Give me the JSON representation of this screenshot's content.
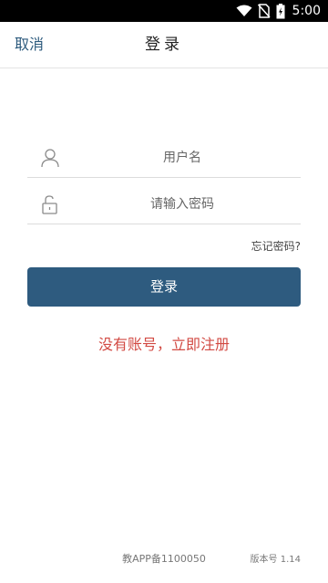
{
  "status_bar": {
    "time": "5:00"
  },
  "header": {
    "cancel": "取消",
    "title": "登录"
  },
  "form": {
    "username_placeholder": "用户名",
    "password_placeholder": "请输入密码",
    "forgot": "忘记密码?",
    "login_label": "登录"
  },
  "register_link": "没有账号，立即注册",
  "footer": {
    "icp": "教APP备1100050",
    "version": "版本号 1.14"
  },
  "colors": {
    "primary": "#2e5b7f",
    "accent_red": "#d24a43",
    "link_blue": "#2c5a7d"
  }
}
